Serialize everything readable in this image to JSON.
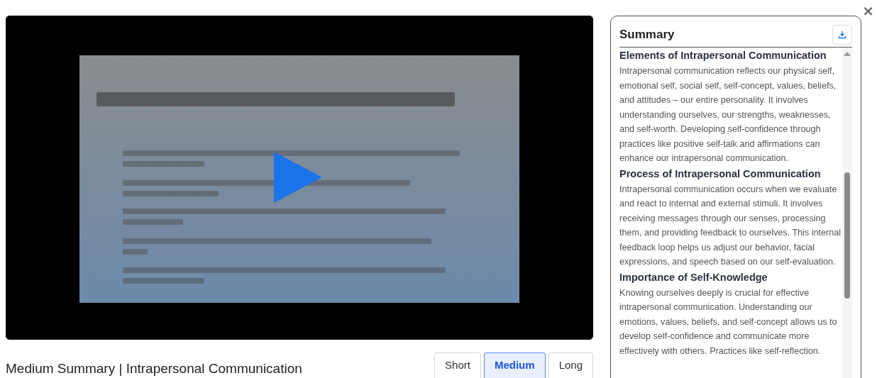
{
  "summary_title": "Medium Summary | Intrapersonal Communication",
  "length_options": [
    {
      "label": "Short",
      "selected": false
    },
    {
      "label": "Medium",
      "selected": true
    },
    {
      "label": "Long",
      "selected": false
    }
  ],
  "close": "×",
  "panel": {
    "title": "Summary",
    "sections": [
      {
        "heading": "Elements of Intrapersonal Communication",
        "text": "Intrapersonal communication reflects our physical self, emotional self, social self, self-concept, values, beliefs, and attitudes – our entire personality. It involves understanding ourselves, our strengths, weaknesses, and self-worth. Developing self-confidence through practices like positive self-talk and affirmations can enhance our intrapersonal communication."
      },
      {
        "heading": "Process of Intrapersonal Communication",
        "text": "Intrapersonal communication occurs when we evaluate and react to internal and external stimuli. It involves receiving messages through our senses, processing them, and providing feedback to ourselves. This internal feedback loop helps us adjust our behavior, facial expressions, and speech based on our self-evaluation."
      },
      {
        "heading": "Importance of Self-Knowledge",
        "text": "Knowing ourselves deeply is crucial for effective intrapersonal communication. Understanding our emotions, values, beliefs, and self-concept allows us to develop self-confidence and communicate more effectively with others. Practices like self-reflection."
      }
    ]
  }
}
